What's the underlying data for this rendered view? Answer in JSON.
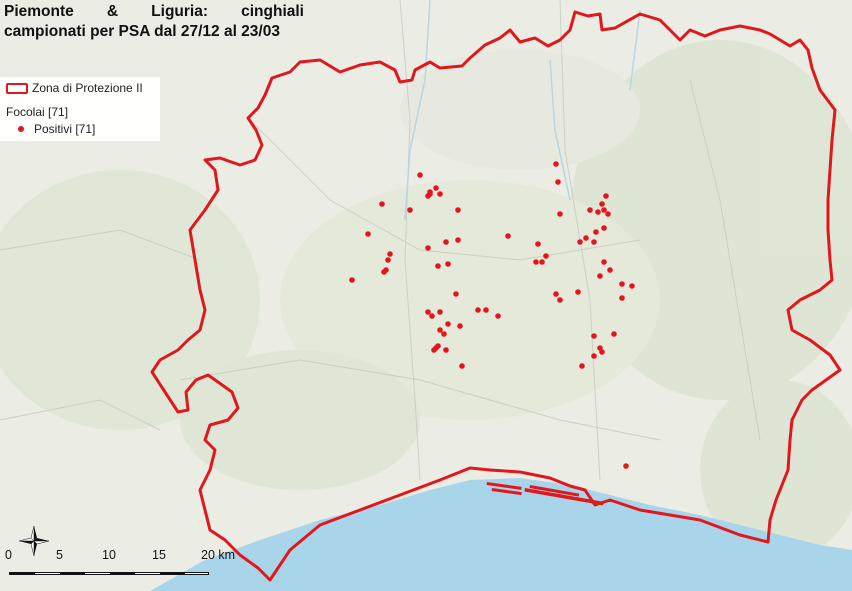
{
  "title": {
    "line1": "Piemonte & Liguria: cinghiali",
    "line2": "campionati per PSA dal 27/12 al 23/03"
  },
  "legend": {
    "zone_label": "Zona di Protezione II",
    "group_label": "Focolai [71]",
    "positive_label": "Positivi [71]"
  },
  "scale": {
    "ticks": [
      "0",
      "5",
      "10",
      "15",
      "20 km"
    ]
  },
  "colors": {
    "zone_border": "#e0181e",
    "positive_marker": "#e0181e",
    "sea": "#a8d4ea",
    "land": "#e9ebe3",
    "terrain": "#dbe4cf"
  },
  "icons": {
    "north_arrow": "compass-rose-icon"
  },
  "positive_count": 71
}
